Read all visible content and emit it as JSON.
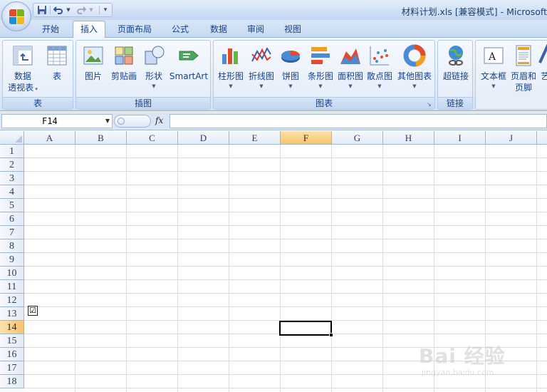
{
  "window": {
    "title": "材料计划.xls  [兼容模式] - Microsoft"
  },
  "tabs": [
    {
      "label": "开始",
      "active": false
    },
    {
      "label": "插入",
      "active": true
    },
    {
      "label": "页面布局",
      "active": false
    },
    {
      "label": "公式",
      "active": false
    },
    {
      "label": "数据",
      "active": false
    },
    {
      "label": "审阅",
      "active": false
    },
    {
      "label": "视图",
      "active": false
    }
  ],
  "ribbon": {
    "groups": {
      "tables": {
        "label": "表",
        "pivot": {
          "line1": "数据",
          "line2": "透视表"
        },
        "table": {
          "label": "表"
        }
      },
      "illustrations": {
        "label": "插图",
        "picture": "图片",
        "clipart": "剪贴画",
        "shapes": "形状",
        "smartart": "SmartArt"
      },
      "charts": {
        "label": "图表",
        "column": "柱形图",
        "line": "折线图",
        "pie": "饼图",
        "bar": "条形图",
        "area": "面积图",
        "scatter": "散点图",
        "other": "其他图表"
      },
      "links": {
        "label": "链接",
        "hyperlink": "超链接"
      },
      "text": {
        "textbox": "文本框",
        "header_footer": {
          "line1": "页眉和",
          "line2": "页脚"
        },
        "art": "艺"
      }
    }
  },
  "formula_bar": {
    "name_box": "F14",
    "fx_label": "fx",
    "formula": ""
  },
  "sheet": {
    "columns": [
      "A",
      "B",
      "C",
      "D",
      "E",
      "F",
      "G",
      "H",
      "I",
      "J"
    ],
    "rows": [
      "1",
      "2",
      "3",
      "4",
      "5",
      "6",
      "7",
      "8",
      "9",
      "10",
      "11",
      "12",
      "13",
      "14",
      "15",
      "16",
      "17",
      "18"
    ],
    "selected_column": "F",
    "selected_row": "14",
    "checkbox_symbol": "☑"
  },
  "watermark": {
    "brand": "Bai 经验",
    "url": "jingyan.baidu.com"
  },
  "colors": {
    "ribbon_text": "#15428b",
    "selected_header": "#f7c36b"
  }
}
